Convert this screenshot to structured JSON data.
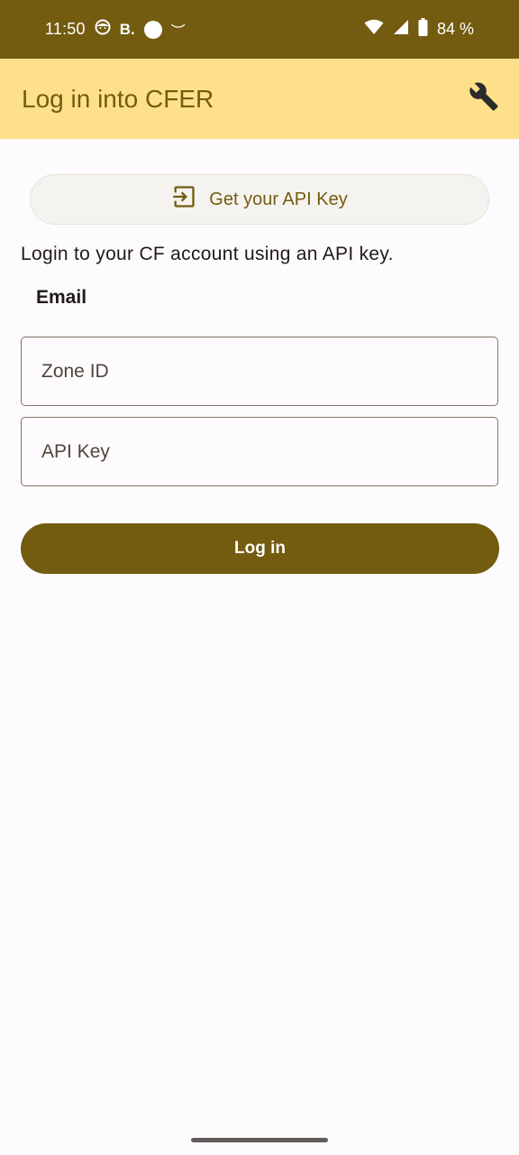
{
  "status_bar": {
    "time": "11:50",
    "notif_b": "B.",
    "notif_smile": "︶",
    "battery": "84 %"
  },
  "app_bar": {
    "title": "Log in into CFER"
  },
  "get_api_key_button": {
    "label": "Get your API Key"
  },
  "login_form": {
    "description": "Login to your CF account using an API key.",
    "email_label": "Email",
    "zone_id_placeholder": "Zone ID",
    "api_key_placeholder": "API Key",
    "login_button": "Log in"
  },
  "colors": {
    "primary": "#735C10",
    "app_bar_bg": "#FFE08A",
    "background": "#FEFBFF"
  }
}
